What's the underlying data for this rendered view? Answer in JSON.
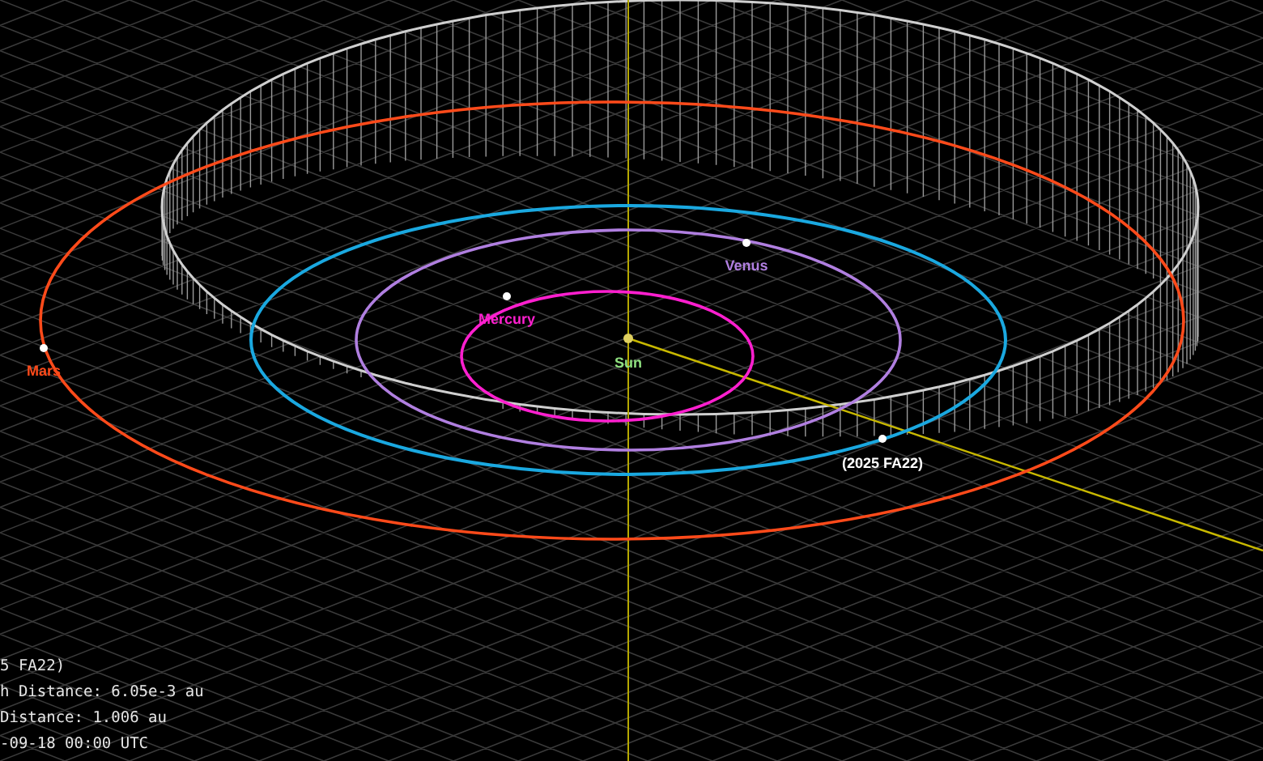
{
  "bodies": [
    {
      "label": "Sun",
      "color": "#8fe07f",
      "kind": "star"
    },
    {
      "label": "Mercury",
      "color": "#ff1fcf",
      "kind": "planet"
    },
    {
      "label": "Venus",
      "color": "#b07fe0",
      "kind": "planet"
    },
    {
      "label": "Mars",
      "color": "#ff4a1a",
      "kind": "planet"
    },
    {
      "label": "(2025 FA22)",
      "color": "#ffffff",
      "kind": "asteroid"
    }
  ],
  "info_lines": [
    "5 FA22)",
    "h Distance: 6.05e-3 au",
    "Distance: 1.006 au",
    "-09-18 00:00 UTC"
  ]
}
